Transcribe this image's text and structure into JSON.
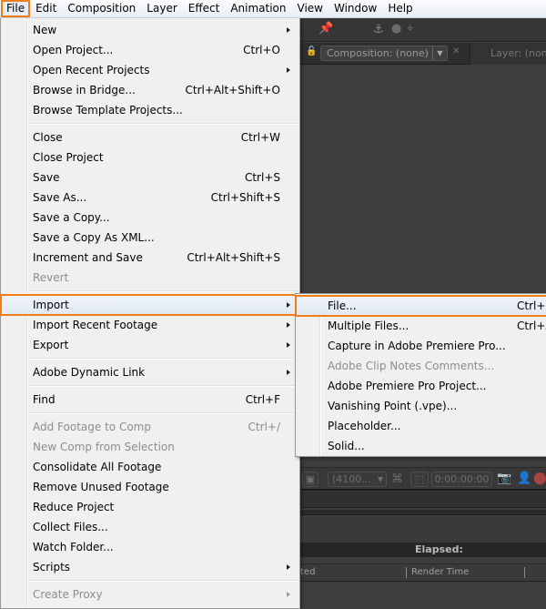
{
  "menubar": {
    "items": [
      {
        "label": "File",
        "active": true
      },
      {
        "label": "Edit"
      },
      {
        "label": "Composition"
      },
      {
        "label": "Layer"
      },
      {
        "label": "Effect"
      },
      {
        "label": "Animation"
      },
      {
        "label": "View"
      },
      {
        "label": "Window"
      },
      {
        "label": "Help"
      }
    ]
  },
  "file_menu": {
    "items": [
      {
        "label": "New",
        "submenu": true
      },
      {
        "label": "Open Project...",
        "shortcut": "Ctrl+O"
      },
      {
        "label": "Open Recent Projects",
        "submenu": true
      },
      {
        "label": "Browse in Bridge...",
        "shortcut": "Ctrl+Alt+Shift+O"
      },
      {
        "label": "Browse Template Projects..."
      },
      {
        "separator": true
      },
      {
        "label": "Close",
        "shortcut": "Ctrl+W"
      },
      {
        "label": "Close Project"
      },
      {
        "label": "Save",
        "shortcut": "Ctrl+S"
      },
      {
        "label": "Save As...",
        "shortcut": "Ctrl+Shift+S"
      },
      {
        "label": "Save a Copy..."
      },
      {
        "label": "Save a Copy As XML..."
      },
      {
        "label": "Increment and Save",
        "shortcut": "Ctrl+Alt+Shift+S"
      },
      {
        "label": "Revert",
        "disabled": true
      },
      {
        "separator": true
      },
      {
        "label": "Import",
        "submenu": true,
        "highlighted": true
      },
      {
        "label": "Import Recent Footage",
        "submenu": true
      },
      {
        "label": "Export",
        "submenu": true
      },
      {
        "separator": true
      },
      {
        "label": "Adobe Dynamic Link",
        "submenu": true
      },
      {
        "separator": true
      },
      {
        "label": "Find",
        "shortcut": "Ctrl+F"
      },
      {
        "separator": true
      },
      {
        "label": "Add Footage to Comp",
        "shortcut": "Ctrl+/",
        "disabled": true
      },
      {
        "label": "New Comp from Selection",
        "disabled": true
      },
      {
        "label": "Consolidate All Footage"
      },
      {
        "label": "Remove Unused Footage"
      },
      {
        "label": "Reduce Project"
      },
      {
        "label": "Collect Files..."
      },
      {
        "label": "Watch Folder..."
      },
      {
        "label": "Scripts",
        "submenu": true
      },
      {
        "separator": true
      },
      {
        "label": "Create Proxy",
        "submenu": true,
        "disabled": true
      }
    ]
  },
  "import_menu": {
    "items": [
      {
        "label": "File...",
        "shortcut": "Ctrl+I",
        "highlighted": true
      },
      {
        "label": "Multiple Files...",
        "shortcut": "Ctrl+Alt+I"
      },
      {
        "label": "Capture in Adobe Premiere Pro..."
      },
      {
        "label": "Adobe Clip Notes Comments...",
        "disabled": true
      },
      {
        "label": "Adobe Premiere Pro Project..."
      },
      {
        "label": "Vanishing Point (.vpe)..."
      },
      {
        "label": "Placeholder..."
      },
      {
        "label": "Solid..."
      }
    ]
  },
  "background": {
    "composition_tab": "Composition: (none)",
    "layer_tab": "Layer: (none)",
    "magnification": "(4100...",
    "timecode": "0:00:00:00",
    "elapsed_label": "Elapsed:",
    "columns": [
      "ted",
      "Render Time"
    ]
  },
  "colors": {
    "highlight_outline": "#f07d18",
    "menu_bg": "#f0f0f0",
    "app_bg": "#3d3d3d"
  }
}
